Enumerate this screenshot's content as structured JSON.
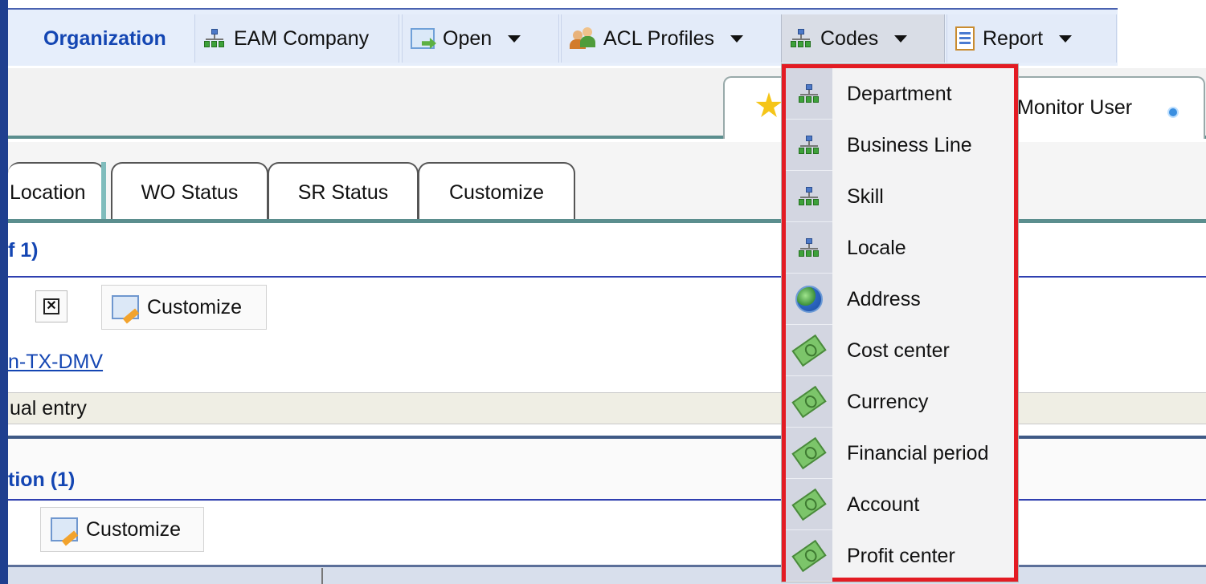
{
  "toolbar": {
    "organization_label": "Organization",
    "items": [
      {
        "label": "EAM Company",
        "icon": "org-tree-icon"
      },
      {
        "label": "Open",
        "icon": "open-icon"
      },
      {
        "label": "ACL Profiles",
        "icon": "users-icon"
      },
      {
        "label": "Codes",
        "icon": "org-tree-icon"
      },
      {
        "label": "Report",
        "icon": "report-icon"
      }
    ]
  },
  "header": {
    "monitor_user_label": "Monitor User"
  },
  "tabs": [
    {
      "label": "Location"
    },
    {
      "label": "WO Status"
    },
    {
      "label": "SR Status"
    },
    {
      "label": "Customize"
    }
  ],
  "section1": {
    "title": "f 1)",
    "customize_label": "Customize",
    "link_text": "n-TX-DMV",
    "entry_text": "ual entry"
  },
  "section2": {
    "title": "tion (1)",
    "customize_label": "Customize"
  },
  "codes_menu": {
    "items": [
      {
        "label": "Department",
        "icon": "org-tree-icon"
      },
      {
        "label": "Business Line",
        "icon": "org-tree-icon"
      },
      {
        "label": "Skill",
        "icon": "org-tree-icon"
      },
      {
        "label": "Locale",
        "icon": "org-tree-icon"
      },
      {
        "label": "Address",
        "icon": "globe-icon"
      },
      {
        "label": "Cost center",
        "icon": "money-icon"
      },
      {
        "label": "Currency",
        "icon": "money-icon"
      },
      {
        "label": "Financial period",
        "icon": "money-icon"
      },
      {
        "label": "Account",
        "icon": "money-icon"
      },
      {
        "label": "Profit center",
        "icon": "money-icon"
      }
    ]
  },
  "colors": {
    "accent": "#1446b3",
    "highlight_border": "#e31b23",
    "tab_line": "#5b8e8e"
  }
}
